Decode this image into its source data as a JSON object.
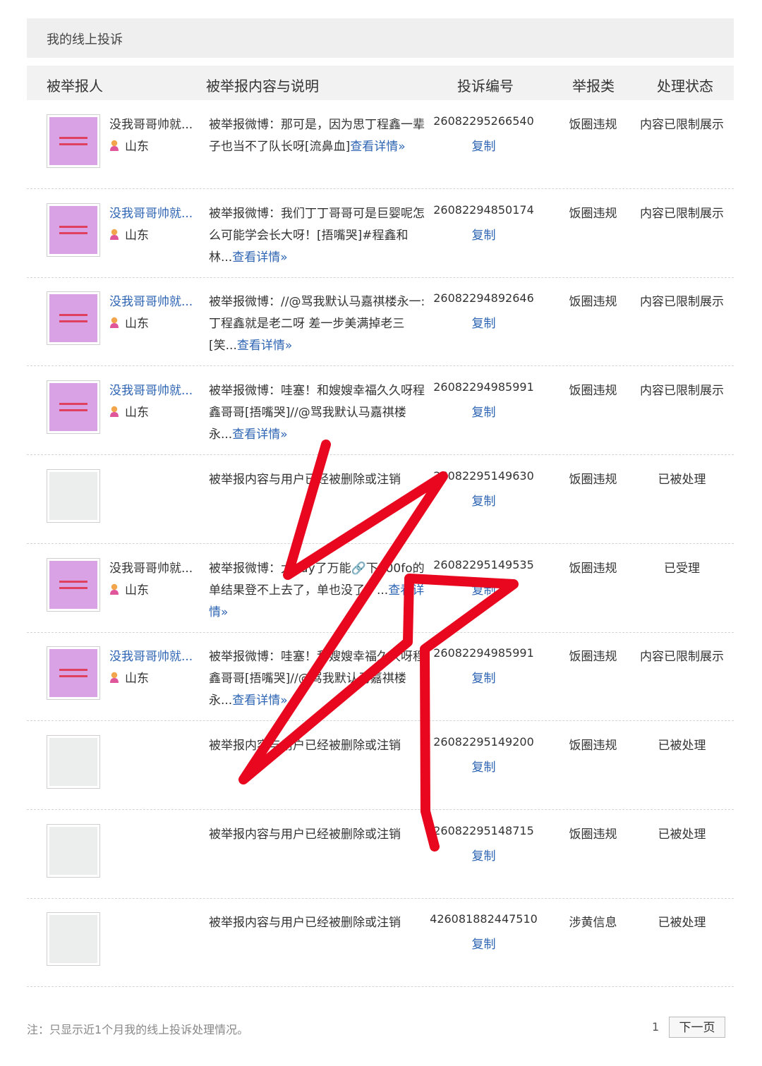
{
  "page_title": "我的线上投诉",
  "columns": {
    "reported": "被举报人",
    "content": "被举报内容与说明",
    "complaint_id": "投诉编号",
    "type": "举报类",
    "status": "处理状态"
  },
  "rows": [
    {
      "avatar": "pink",
      "user_name": "没我哥哥帅就...",
      "user_name_link": false,
      "location": "山东",
      "desc_text": "被举报微博：那可是，因为思丁程鑫一辈子也当不了队长呀[流鼻血]",
      "more": "查看详情»",
      "complaint_id": "26082295266540",
      "copy": "复制",
      "type": "饭圈违规",
      "status": "内容已限制展示"
    },
    {
      "avatar": "pink",
      "user_name": "没我哥哥帅就...",
      "user_name_link": true,
      "location": "山东",
      "desc_text": "被举报微博：我们丁丁哥哥可是巨婴呢怎么可能学会长大呀！[捂嘴哭]#程鑫和林...",
      "more": "查看详情»",
      "complaint_id": "26082294850174",
      "copy": "复制",
      "type": "饭圈违规",
      "status": "内容已限制展示"
    },
    {
      "avatar": "pink",
      "user_name": "没我哥哥帅就...",
      "user_name_link": true,
      "location": "山东",
      "desc_text": "被举报微博：//@骂我默认马嘉祺楼永一:丁程鑫就是老二呀 差一步美满掉老三[笑...",
      "more": "查看详情»",
      "complaint_id": "26082294892646",
      "copy": "复制",
      "type": "饭圈违规",
      "status": "内容已限制展示"
    },
    {
      "avatar": "pink",
      "user_name": "没我哥哥帅就...",
      "user_name_link": true,
      "location": "山东",
      "desc_text": "被举报微博：哇塞！和嫂嫂幸福久久呀程鑫哥哥[捂嘴哭]//@骂我默认马嘉祺楼永...",
      "more": "查看详情»",
      "complaint_id": "26082294985991",
      "copy": "复制",
      "type": "饭圈违规",
      "status": "内容已限制展示"
    },
    {
      "avatar": "gray",
      "user_name": "",
      "user_name_link": false,
      "location": "",
      "desc_text": "被举报内容与用户已经被删除或注销",
      "more": "",
      "complaint_id": "26082295149630",
      "copy": "复制",
      "type": "饭圈违规",
      "status": "已被处理"
    },
    {
      "avatar": "pink",
      "user_name": "没我哥哥帅就...",
      "user_name_link": false,
      "location": "山东",
      "desc_text": "被举报微博：太buy了万能🔗下100fo的单结果登不上去了，单也没了，...",
      "more": "查看详情»",
      "complaint_id": "26082295149535",
      "copy": "复制",
      "type": "饭圈违规",
      "status": "已受理"
    },
    {
      "avatar": "pink",
      "user_name": "没我哥哥帅就...",
      "user_name_link": true,
      "location": "山东",
      "desc_text": "被举报微博：哇塞！和嫂嫂幸福久久呀程鑫哥哥[捂嘴哭]//@骂我默认马嘉祺楼永...",
      "more": "查看详情»",
      "complaint_id": "26082294985991",
      "copy": "复制",
      "type": "饭圈违规",
      "status": "内容已限制展示"
    },
    {
      "avatar": "gray",
      "user_name": "",
      "user_name_link": false,
      "location": "",
      "desc_text": "被举报内容与用户已经被删除或注销",
      "more": "",
      "complaint_id": "26082295149200",
      "copy": "复制",
      "type": "饭圈违规",
      "status": "已被处理"
    },
    {
      "avatar": "gray",
      "user_name": "",
      "user_name_link": false,
      "location": "",
      "desc_text": "被举报内容与用户已经被删除或注销",
      "more": "",
      "complaint_id": "26082295148715",
      "copy": "复制",
      "type": "饭圈违规",
      "status": "已被处理"
    },
    {
      "avatar": "gray",
      "user_name": "",
      "user_name_link": false,
      "location": "",
      "desc_text": "被举报内容与用户已经被删除或注销",
      "more": "",
      "complaint_id": "426081882447510",
      "copy": "复制",
      "type": "涉黄信息",
      "status": "已被处理"
    }
  ],
  "footer": {
    "note": "注：只显示近1个月我的线上投诉处理情况。",
    "page_number": "1",
    "next_label": "下一页"
  },
  "colors": {
    "link": "#2d64b3",
    "scribble": "#e8071e",
    "header_bg": "#f2f2f2"
  }
}
